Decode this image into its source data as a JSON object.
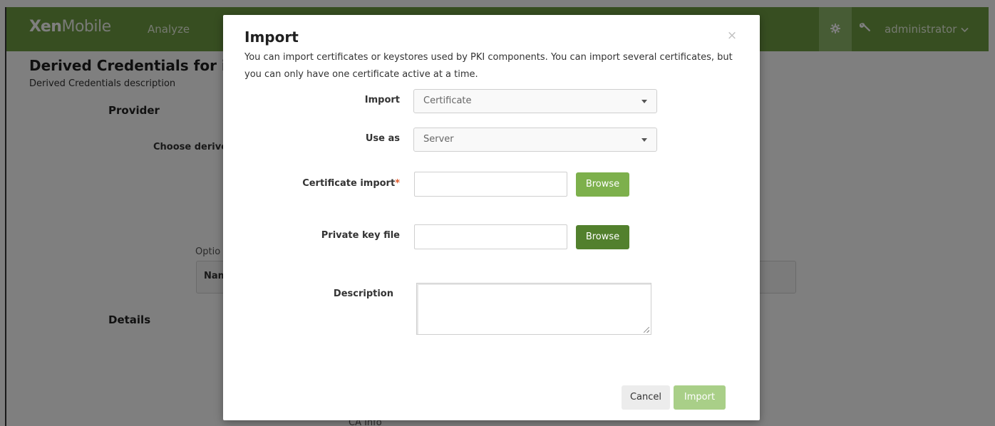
{
  "topbar": {
    "brand_bold": "Xen",
    "brand_light": "Mobile",
    "nav_analyze": "Analyze",
    "settings_icon": "gear-icon",
    "tools_icon": "wrench-icon",
    "user_label": "administrator",
    "user_caret_icon": "chevron-down-icon",
    "bar_color": "#6e9d43"
  },
  "background_page": {
    "title": "Derived Credentials for iC",
    "description": "Derived Credentials description",
    "provider_heading": "Provider",
    "choose_label": "Choose derive",
    "option_label": "Optio",
    "table_name_header": "Nam",
    "details_heading": "Details",
    "ca_info": "CA Info"
  },
  "modal": {
    "title": "Import",
    "close_symbol": "×",
    "intro": "You can import certificates or keystores used by PKI components. You can import several certificates, but you can only have one certificate active at a time.",
    "import_label": "Import",
    "import_value": "Certificate",
    "use_as_label": "Use as",
    "use_as_value": "Server",
    "certificate_import_label": "Certificate import",
    "required_mark": "*",
    "private_key_label": "Private key file",
    "browse_label": "Browse",
    "description_label": "Description",
    "cancel_label": "Cancel",
    "import_button_label": "Import",
    "accent_color": "#7db04c",
    "required_color": "#e05a2b"
  }
}
